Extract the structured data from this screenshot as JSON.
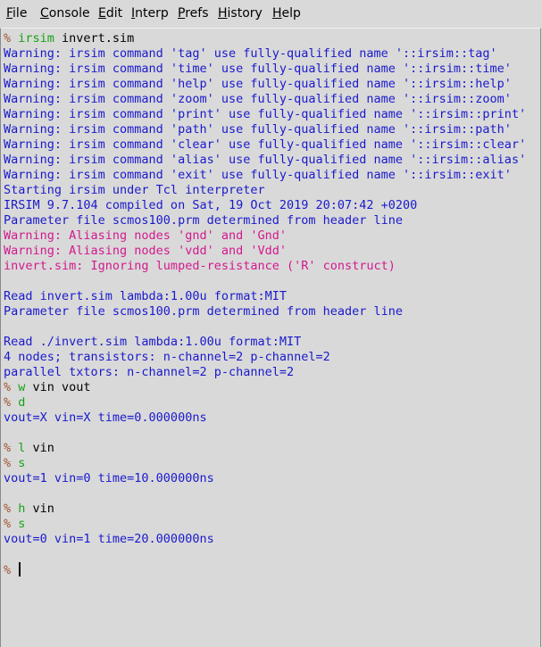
{
  "menu": {
    "items": [
      {
        "underline": "F",
        "rest": "ile",
        "name": "file"
      },
      {
        "underline": "C",
        "rest": "onsole",
        "name": "console"
      },
      {
        "underline": "E",
        "rest": "dit",
        "name": "edit"
      },
      {
        "underline": "I",
        "rest": "nterp",
        "name": "interp"
      },
      {
        "underline": "P",
        "rest": "refs",
        "name": "prefs"
      },
      {
        "underline": "H",
        "rest": "istory",
        "name": "history"
      },
      {
        "underline": "H",
        "rest": "elp",
        "name": "help"
      }
    ]
  },
  "colors": {
    "background": "#d9d9d9",
    "prompt": "#a0522d",
    "command": "#15a315",
    "output": "#1a1acd",
    "error": "#d3198e"
  },
  "console": {
    "lines": [
      {
        "type": "command",
        "prompt": "% ",
        "cmd": "irsim",
        "args": " invert.sim"
      },
      {
        "type": "out",
        "text": "Warning: irsim command 'tag' use fully-qualified name '::irsim::tag'"
      },
      {
        "type": "out",
        "text": "Warning: irsim command 'time' use fully-qualified name '::irsim::time'"
      },
      {
        "type": "out",
        "text": "Warning: irsim command 'help' use fully-qualified name '::irsim::help'"
      },
      {
        "type": "out",
        "text": "Warning: irsim command 'zoom' use fully-qualified name '::irsim::zoom'"
      },
      {
        "type": "out",
        "text": "Warning: irsim command 'print' use fully-qualified name '::irsim::print'"
      },
      {
        "type": "out",
        "text": "Warning: irsim command 'path' use fully-qualified name '::irsim::path'"
      },
      {
        "type": "out",
        "text": "Warning: irsim command 'clear' use fully-qualified name '::irsim::clear'"
      },
      {
        "type": "out",
        "text": "Warning: irsim command 'alias' use fully-qualified name '::irsim::alias'"
      },
      {
        "type": "out",
        "text": "Warning: irsim command 'exit' use fully-qualified name '::irsim::exit'"
      },
      {
        "type": "out",
        "text": "Starting irsim under Tcl interpreter"
      },
      {
        "type": "out",
        "text": "IRSIM 9.7.104 compiled on Sat, 19 Oct 2019 20:07:42 +0200"
      },
      {
        "type": "out",
        "text": "Parameter file scmos100.prm determined from header line"
      },
      {
        "type": "err",
        "text": "Warning: Aliasing nodes 'gnd' and 'Gnd'"
      },
      {
        "type": "err",
        "text": "Warning: Aliasing nodes 'vdd' and 'Vdd'"
      },
      {
        "type": "err",
        "text": "invert.sim: Ignoring lumped-resistance ('R' construct)"
      },
      {
        "type": "out",
        "text": ""
      },
      {
        "type": "out",
        "text": "Read invert.sim lambda:1.00u format:MIT"
      },
      {
        "type": "out",
        "text": "Parameter file scmos100.prm determined from header line"
      },
      {
        "type": "out",
        "text": ""
      },
      {
        "type": "out",
        "text": "Read ./invert.sim lambda:1.00u format:MIT"
      },
      {
        "type": "out",
        "text": "4 nodes; transistors: n-channel=2 p-channel=2"
      },
      {
        "type": "out",
        "text": "parallel txtors: n-channel=2 p-channel=2"
      },
      {
        "type": "command",
        "prompt": "% ",
        "cmd": "w",
        "args": " vin vout"
      },
      {
        "type": "command",
        "prompt": "% ",
        "cmd": "d",
        "args": ""
      },
      {
        "type": "out",
        "text": "vout=X vin=X time=0.000000ns"
      },
      {
        "type": "out",
        "text": ""
      },
      {
        "type": "command",
        "prompt": "% ",
        "cmd": "l",
        "args": " vin"
      },
      {
        "type": "command",
        "prompt": "% ",
        "cmd": "s",
        "args": ""
      },
      {
        "type": "out",
        "text": "vout=1 vin=0 time=10.000000ns"
      },
      {
        "type": "out",
        "text": ""
      },
      {
        "type": "command",
        "prompt": "% ",
        "cmd": "h",
        "args": " vin"
      },
      {
        "type": "command",
        "prompt": "% ",
        "cmd": "s",
        "args": ""
      },
      {
        "type": "out",
        "text": "vout=0 vin=1 time=20.000000ns"
      },
      {
        "type": "out",
        "text": ""
      },
      {
        "type": "input",
        "prompt": "% ",
        "value": ""
      }
    ]
  }
}
